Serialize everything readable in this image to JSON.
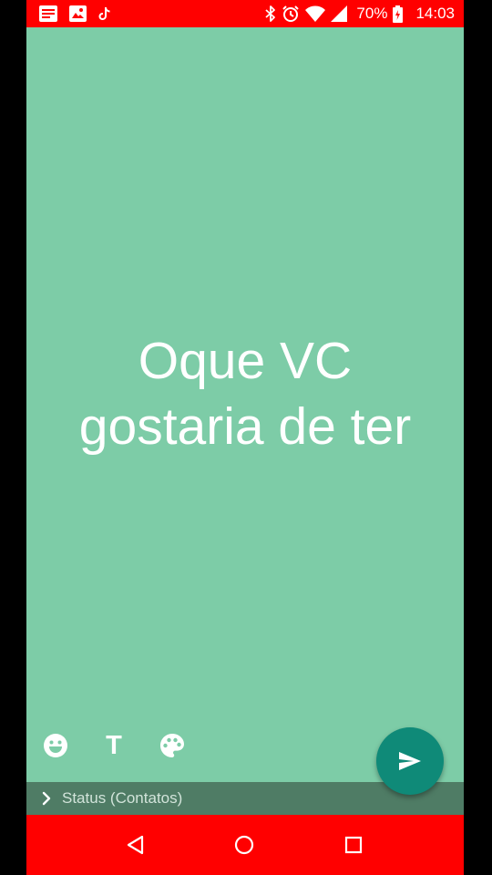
{
  "status_bar": {
    "notification_icons": [
      "news-icon",
      "gallery-icon",
      "tiktok-icon"
    ],
    "system_icons": [
      "bluetooth-icon",
      "alarm-icon",
      "wifi-icon",
      "signal-icon",
      "battery-icon"
    ],
    "battery_percent": "70%",
    "time": "14:03",
    "color": "#ff0000"
  },
  "composer": {
    "background_color": "#7dcca7",
    "text_lines": [
      "Oque VC",
      "gostaria de ter"
    ],
    "tools": [
      {
        "name": "emoji-icon"
      },
      {
        "name": "text-style-icon",
        "label": "T"
      },
      {
        "name": "palette-icon"
      }
    ]
  },
  "audience": {
    "label": "Status (Contatos)",
    "icon": "chevron-right-icon"
  },
  "send_button": {
    "icon": "send-icon",
    "color": "#0f8a78"
  },
  "nav_bar": {
    "buttons": [
      "back-icon",
      "home-icon",
      "recents-icon"
    ],
    "color": "#ff0000"
  }
}
